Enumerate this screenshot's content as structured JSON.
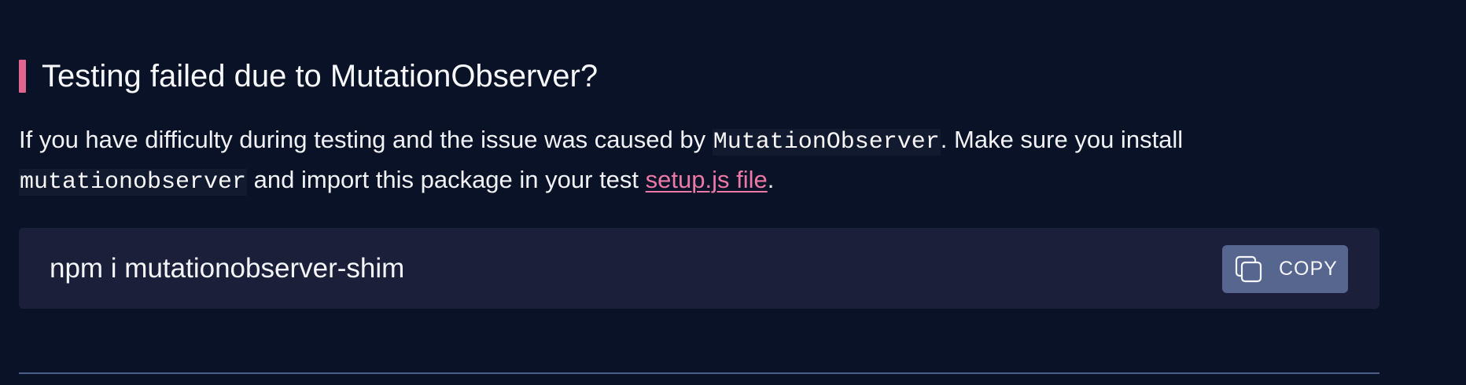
{
  "section": {
    "title": "Testing failed due to MutationObserver?",
    "paragraph": {
      "text_1": "If you have difficulty during testing and the issue was caused by ",
      "code_1": "MutationObserver",
      "text_2": ". Make sure you install ",
      "code_2": "mutationobserver",
      "text_3": " and import this package in your test ",
      "link": "setup.js file",
      "text_4": "."
    }
  },
  "code_block": {
    "command": "npm i mutationobserver-shim",
    "copy_label": "COPY",
    "copy_icon": "copy-icon"
  },
  "colors": {
    "background": "#0a1227",
    "accent": "#e0668f",
    "link": "#ea79a6",
    "code_block_bg": "#1c1f3a",
    "copy_button_bg": "#56668f",
    "divider": "#4d5d8a"
  }
}
